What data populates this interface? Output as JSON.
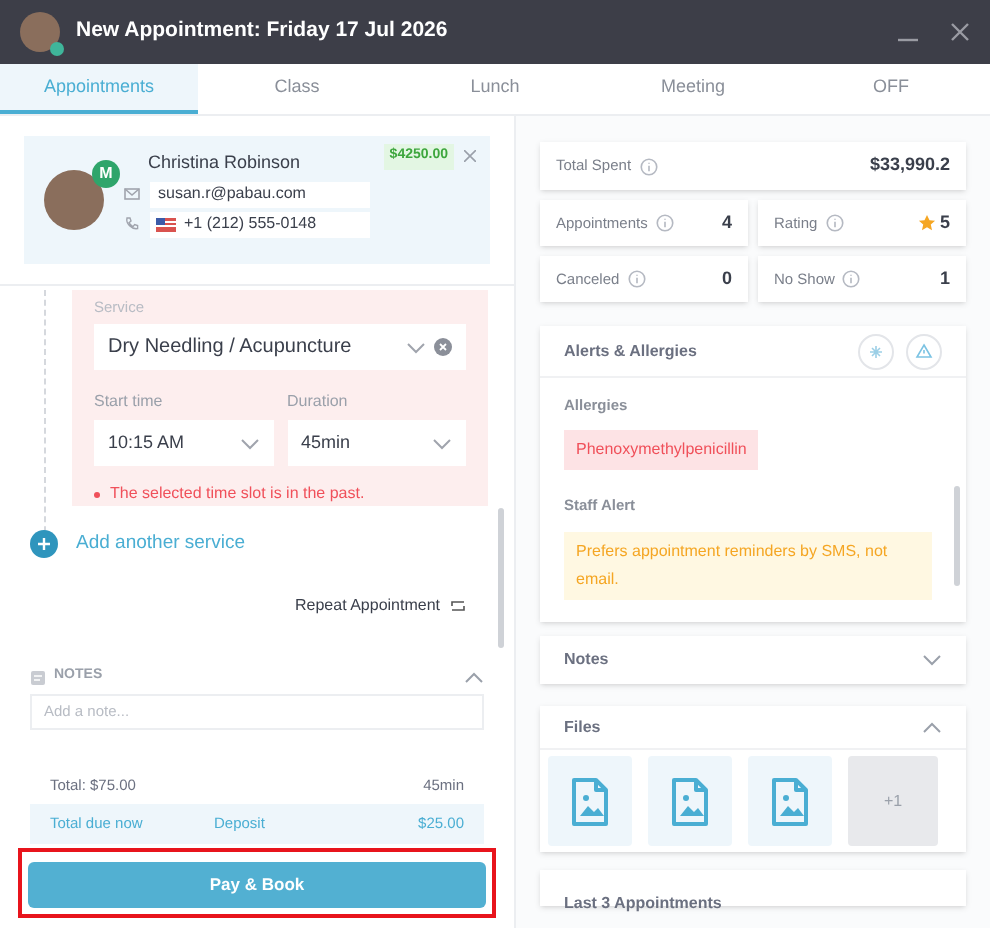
{
  "window": {
    "title": "New Appointment: Friday 17 Jul 2026"
  },
  "tabs": [
    {
      "label": "Appointments",
      "selected": true
    },
    {
      "label": "Class",
      "selected": false
    },
    {
      "label": "Lunch",
      "selected": false
    },
    {
      "label": "Meeting",
      "selected": false
    },
    {
      "label": "OFF",
      "selected": false
    }
  ],
  "client": {
    "name": "Christina Robinson",
    "badge": "M",
    "amount": "$4250.00",
    "email": "susan.r@pabau.com",
    "phone": "+1 (212) 555-0148"
  },
  "service": {
    "label": "Service",
    "value": "Dry Needling / Acupuncture"
  },
  "start_time": {
    "label": "Start time",
    "value": "10:15 AM"
  },
  "duration": {
    "label": "Duration",
    "value": "45min"
  },
  "error": "The selected time slot is in the past.",
  "add_service": "Add another service",
  "repeat": "Repeat Appointment",
  "notes": {
    "title": "NOTES",
    "expanded": true,
    "placeholder": "Add a note..."
  },
  "total": {
    "label": "Total: $75.00",
    "duration": "45min"
  },
  "due": {
    "label": "Total due now",
    "type": "Deposit",
    "amount": "$25.00"
  },
  "pay_button": "Pay & Book",
  "total_spent": {
    "label": "Total Spent",
    "value": "$33,990.2"
  },
  "stats": [
    {
      "label": "Appointments",
      "value": "4",
      "kind": "number"
    },
    {
      "label": "Rating",
      "value": "5",
      "kind": "rating"
    },
    {
      "label": "Canceled",
      "value": "0",
      "kind": "number"
    },
    {
      "label": "No Show",
      "value": "1",
      "kind": "number"
    }
  ],
  "alerts": {
    "title": "Alerts & Allergies",
    "allergies_label": "Allergies",
    "allergy": "Phenoxymethylpenicillin",
    "staff_label": "Staff Alert",
    "staff_alert": "Prefers appointment reminders by SMS, not email."
  },
  "notes_panel": {
    "title": "Notes",
    "expanded": false
  },
  "files": {
    "title": "Files",
    "expanded": true,
    "items": [
      {
        "kind": "image"
      },
      {
        "kind": "image"
      },
      {
        "kind": "image"
      },
      {
        "kind": "more",
        "label": "+1"
      }
    ]
  },
  "last_appointments": {
    "title": "Last 3 Appointments"
  }
}
